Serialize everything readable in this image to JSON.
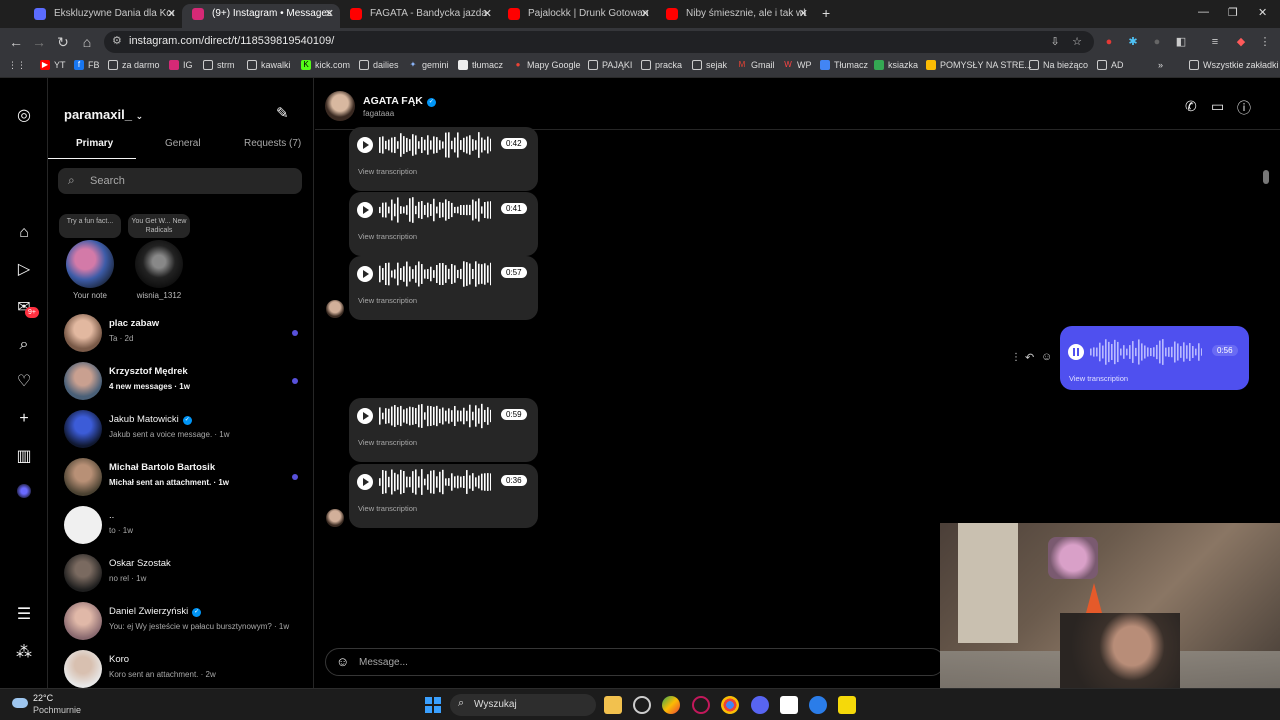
{
  "browser": {
    "tabs": [
      {
        "label": "Ekskluzywne Dania dla Koneserów",
        "favicon_color": "#5b6cff"
      },
      {
        "label": "(9+) Instagram • Messages",
        "favicon_color": "#d62976",
        "active": true
      },
      {
        "label": "FAGATA - Bandycka jazda - YouTube",
        "favicon_color": "#ff0000"
      },
      {
        "label": "Pajalockk | Drunk Gotowanie z A",
        "favicon_color": "#ff0000"
      },
      {
        "label": "Niby śmiesznie, ale i tak wkurza",
        "favicon_color": "#ff0000"
      }
    ],
    "url": "instagram.com/direct/t/118539819540109/",
    "bookmarks": [
      "YT",
      "FB",
      "za darmo",
      "IG",
      "strm",
      "kawalki",
      "kick.com",
      "dailies",
      "gemini",
      "tłumacz",
      "Mapy Google",
      "PAJĄKI",
      "pracka",
      "sejak",
      "Gmail",
      "WP",
      "Tłumacz",
      "ksiazka",
      "POMYSŁY NA STRE...",
      "Na bieżąco",
      "AD"
    ],
    "all_bookmarks": "Wszystkie zakładki"
  },
  "inbox": {
    "username": "paramaxil_",
    "tabs": [
      "Primary",
      "General",
      "Requests (7)"
    ],
    "search_placeholder": "Search",
    "notes": [
      {
        "bubble": "Try a fun fact...",
        "name": "Your note"
      },
      {
        "bubble": "You Get W... New Radicals",
        "name": "wisnia_1312"
      }
    ],
    "conversations": [
      {
        "name": "plac zabaw",
        "sub": "Ta · 2d",
        "unread": true,
        "bold": false
      },
      {
        "name": "Krzysztof Mędrek",
        "sub": "4 new messages · 1w",
        "unread": true,
        "bold": true
      },
      {
        "name": "Jakub Matowicki",
        "sub": "Jakub sent a voice message. · 1w",
        "unread": false,
        "bold": false,
        "verified": true
      },
      {
        "name": "Michał Bartolo Bartosik",
        "sub": "Michał sent an attachment. · 1w",
        "unread": true,
        "bold": true
      },
      {
        "name": "..",
        "sub": "to · 1w",
        "unread": false,
        "bold": false
      },
      {
        "name": "Oskar Szostak",
        "sub": "no rel · 1w",
        "unread": false,
        "bold": false
      },
      {
        "name": "Daniel Zwierzyński",
        "sub": "You: ej Wy jesteście w pałacu bursztynowym? · 1w",
        "unread": false,
        "bold": false,
        "verified": true
      },
      {
        "name": "Koro",
        "sub": "Koro sent an attachment. · 2w",
        "unread": false,
        "bold": false
      }
    ]
  },
  "rail": {
    "badge": "9+"
  },
  "chat": {
    "name": "AGATA FĄK",
    "handle": "fagataaa",
    "transcription_label": "View transcription",
    "messages": [
      {
        "duration": "0:42",
        "sent": false
      },
      {
        "duration": "0:41",
        "sent": false
      },
      {
        "duration": "0:57",
        "sent": false
      },
      {
        "duration": "0:56",
        "sent": true
      },
      {
        "duration": "0:59",
        "sent": false
      },
      {
        "duration": "0:36",
        "sent": false
      }
    ],
    "composer_placeholder": "Message..."
  },
  "taskbar": {
    "temperature": "22°C",
    "weather": "Pochmurnie",
    "search_placeholder": "Wyszukaj"
  },
  "colors": {
    "accent": "#4f50ef",
    "unread_dot": "#5851db",
    "badge": "#ff3040"
  }
}
